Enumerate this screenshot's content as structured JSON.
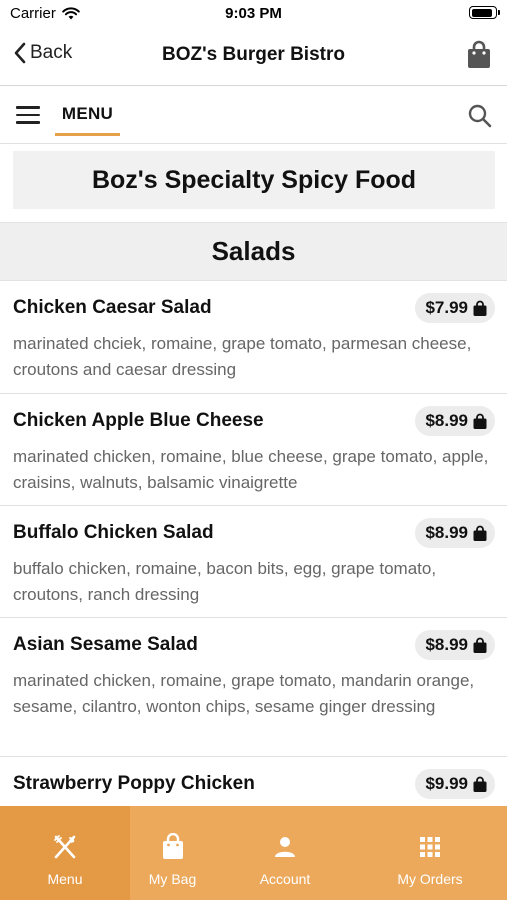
{
  "status_bar": {
    "carrier": "Carrier",
    "time": "9:03 PM"
  },
  "nav": {
    "back_label": "Back",
    "title": "BOZ's Burger Bistro"
  },
  "menu_bar": {
    "tab_label": "MENU"
  },
  "banner": {
    "title": "Boz's Specialty Spicy Food"
  },
  "section": {
    "title": "Salads"
  },
  "items": [
    {
      "name": "Chicken Caesar Salad",
      "price": "$7.99",
      "description": "marinated chciek, romaine, grape tomato, parmesan cheese, croutons and caesar dressing"
    },
    {
      "name": "Chicken Apple Blue Cheese",
      "price": "$8.99",
      "description": "marinated chicken, romaine, blue cheese, grape tomato, apple, craisins, walnuts, balsamic vinaigrette"
    },
    {
      "name": "Buffalo Chicken Salad",
      "price": "$8.99",
      "description": "buffalo chicken, romaine, bacon bits, egg, grape tomato, croutons, ranch dressing"
    },
    {
      "name": "Asian Sesame Salad",
      "price": "$8.99",
      "description": "marinated chicken, romaine, grape tomato, mandarin orange, sesame, cilantro, wonton chips, sesame ginger dressing"
    },
    {
      "name": "Strawberry Poppy Chicken",
      "price": "$9.99",
      "description": ""
    }
  ],
  "tab_bar": {
    "menu": "Menu",
    "bag": "My Bag",
    "account": "Account",
    "orders": "My Orders"
  },
  "colors": {
    "accent": "#eca95c",
    "accent_active": "#e49a45",
    "underline": "#e8a14b"
  }
}
